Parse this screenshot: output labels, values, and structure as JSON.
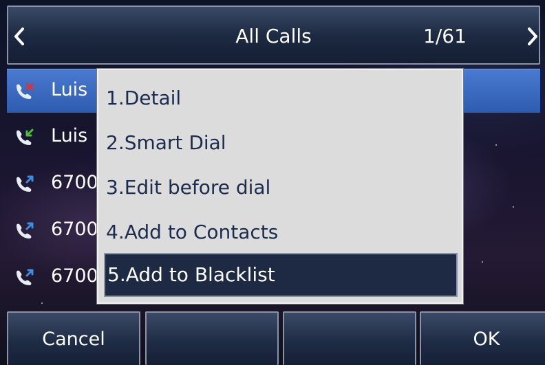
{
  "header": {
    "title": "All Calls",
    "counter": "1/61",
    "left_arrow_icon": "chevron-left-icon",
    "right_arrow_icon": "chevron-right-icon"
  },
  "call_list": [
    {
      "name": "Luis",
      "type": "missed",
      "icon": "missed-call-icon",
      "selected": true
    },
    {
      "name": "Luis",
      "type": "received",
      "icon": "received-call-icon",
      "selected": false
    },
    {
      "name": "6700",
      "type": "dialed",
      "icon": "dialed-call-icon",
      "selected": false
    },
    {
      "name": "6700",
      "type": "dialed",
      "icon": "dialed-call-icon",
      "selected": false
    },
    {
      "name": "6700",
      "type": "dialed",
      "icon": "dialed-call-icon",
      "selected": false
    }
  ],
  "menu": {
    "items": [
      {
        "label": "1.Detail"
      },
      {
        "label": "2.Smart Dial"
      },
      {
        "label": "3.Edit before dial"
      },
      {
        "label": "4.Add to Contacts"
      },
      {
        "label": "5.Add to Blacklist"
      }
    ],
    "selected_index": 4
  },
  "softkeys": [
    "Cancel",
    "",
    "",
    "OK"
  ],
  "colors": {
    "selected_row": "#2d5bb0",
    "menu_background": "#dcdcdc",
    "menu_text": "#1c2c4e",
    "menu_highlight": "#1e2a44",
    "missed_mark": "#e03030",
    "received_arrow": "#4bbf3a",
    "dialed_arrow": "#3d8ee0"
  }
}
